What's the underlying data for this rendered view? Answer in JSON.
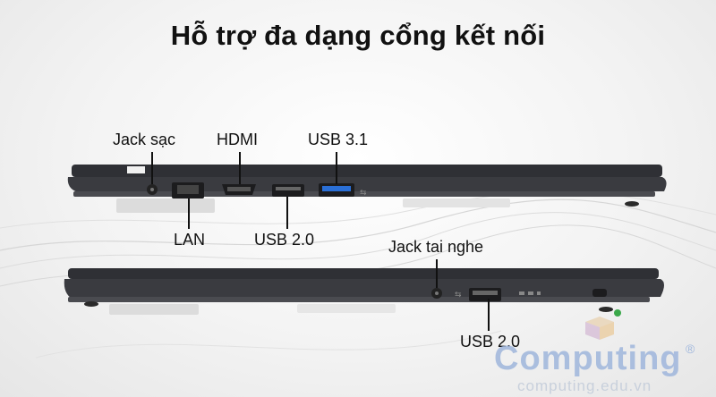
{
  "heading": "Hỗ trợ đa dạng cổng kết nối",
  "top_ports": {
    "charging": "Jack sạc",
    "hdmi": "HDMI",
    "usb31": "USB 3.1",
    "lan": "LAN",
    "usb20": "USB 2.0"
  },
  "bottom_ports": {
    "audio": "Jack tai nghe",
    "usb20": "USB 2.0"
  },
  "watermark": {
    "brand": "Computing",
    "registered": "®",
    "url": "computing.edu.vn"
  },
  "colors": {
    "laptop_body": "#3a3b40",
    "usb31_blue": "#2a6fd6",
    "logo_blue": "#9fb6dc"
  }
}
